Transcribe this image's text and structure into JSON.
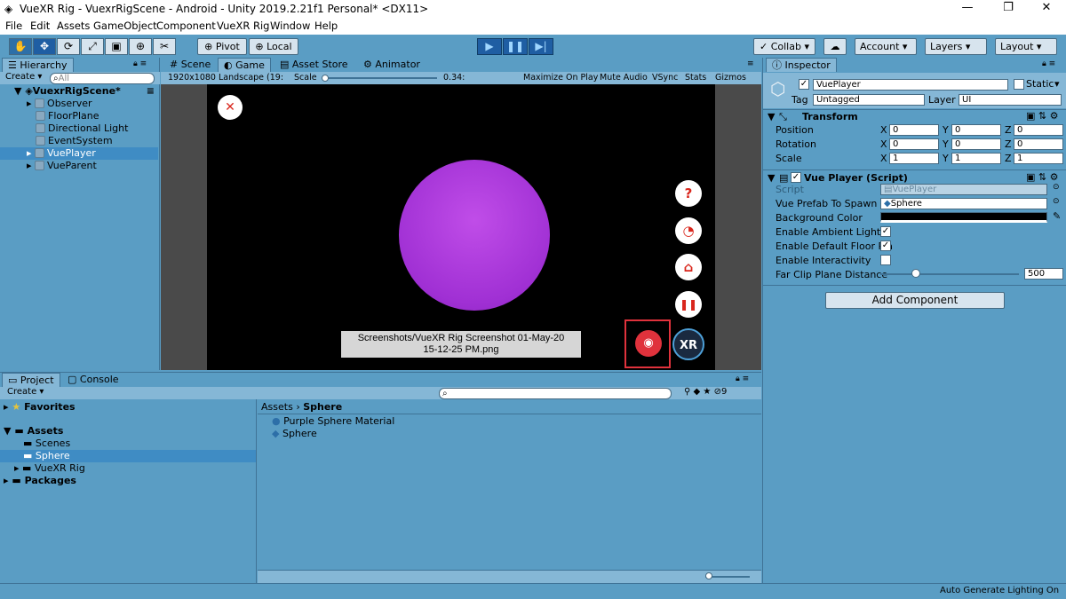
{
  "window": {
    "title": "VueXR Rig - VuexrRigScene - Android - Unity 2019.2.21f1 Personal* <DX11>",
    "minimize": "—",
    "restore": "❐",
    "close": "✕"
  },
  "menu": [
    "File",
    "Edit",
    "Assets",
    "GameObject",
    "Component",
    "VueXR Rig",
    "Window",
    "Help"
  ],
  "toolbar": {
    "pivot": "Pivot",
    "local": "Local",
    "collab": "Collab ▾",
    "account": "Account",
    "layers": "Layers",
    "layout": "Layout"
  },
  "hierarchy": {
    "tab": "Hierarchy",
    "create": "Create",
    "search_placeholder": "All",
    "scene": "VuexrRigScene*",
    "items": [
      "Observer",
      "FloorPlane",
      "Directional Light",
      "EventSystem",
      "VuePlayer",
      "VueParent"
    ]
  },
  "center_tabs": {
    "scene": "Scene",
    "game": "Game",
    "asset_store": "Asset Store",
    "animator": "Animator"
  },
  "game_bar": {
    "resolution": "1920x1080 Landscape (19:",
    "scale_label": "Scale",
    "scale_value": "0.34:",
    "maximize": "Maximize On Play",
    "mute": "Mute Audio",
    "vsync": "VSync",
    "stats": "Stats",
    "gizmos": "Gizmos"
  },
  "game_view": {
    "screenshot_line1": "Screenshots/VueXR Rig Screenshot 01-May-20",
    "screenshot_line2": "15-12-25 PM.png",
    "xr_label": "XR",
    "sphere_color": "#b23fe0"
  },
  "inspector": {
    "tab": "Inspector",
    "object": "VuePlayer",
    "static": "Static",
    "tag_label": "Tag",
    "tag_value": "Untagged",
    "layer_label": "Layer",
    "layer_value": "UI",
    "transform": {
      "title": "Transform",
      "rows": [
        {
          "label": "Position",
          "x": "0",
          "y": "0",
          "z": "0"
        },
        {
          "label": "Rotation",
          "x": "0",
          "y": "0",
          "z": "0"
        },
        {
          "label": "Scale",
          "x": "1",
          "y": "1",
          "z": "1"
        }
      ]
    },
    "script": {
      "title": "Vue Player (Script)",
      "script_label": "Script",
      "script_value": "VuePlayer",
      "prefab_label": "Vue Prefab To Spawn",
      "prefab_value": "Sphere",
      "bg_label": "Background Color",
      "ambient_label": "Enable Ambient Light",
      "floor_label": "Enable Default Floor Pla",
      "interact_label": "Enable Interactivity",
      "farclip_label": "Far Clip Plane Distance",
      "farclip_value": "500",
      "farclip_fraction": 0.03
    },
    "add_component": "Add Component"
  },
  "project": {
    "tab": "Project",
    "console_tab": "Console",
    "create": "Create",
    "tree": {
      "favorites": "Favorites",
      "assets": "Assets",
      "scenes": "Scenes",
      "sphere": "Sphere",
      "vuexr": "VueXR Rig",
      "packages": "Packages"
    },
    "breadcrumb_root": "Assets",
    "breadcrumb_current": "Sphere",
    "files": [
      "Purple Sphere Material",
      "Sphere"
    ],
    "hidden_count": "9"
  },
  "status": {
    "text": "Auto Generate Lighting On"
  }
}
